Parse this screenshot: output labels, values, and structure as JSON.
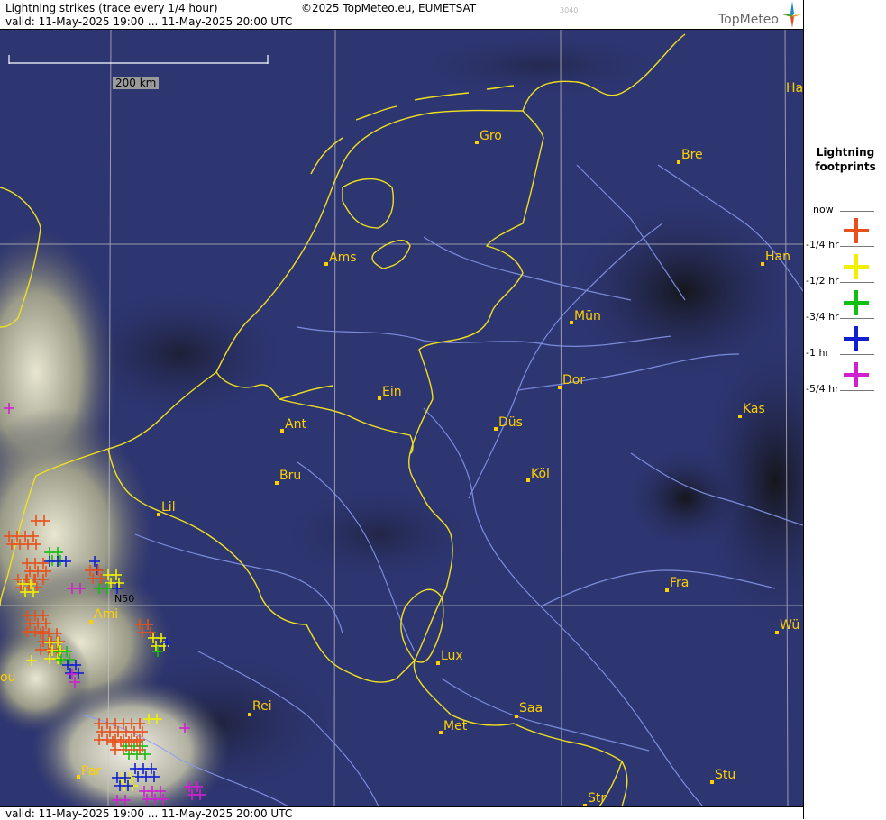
{
  "header": {
    "title": "Lightning strikes (trace every 1/4 hour)",
    "copyright": "©2025 TopMeteo.eu, EUMETSAT",
    "code": "3040",
    "valid": "valid:  11-May-2025 19:00 ... 11-May-2025 20:00 UTC",
    "logo": "TopMeteo"
  },
  "footer": {
    "valid": "valid:  11-May-2025 19:00 ... 11-May-2025 20:00 UTC"
  },
  "map": {
    "scale_label": "200 km",
    "lat_label": "N50",
    "cities": [
      "Gro",
      "Bre",
      "Ha",
      "Ams",
      "Han",
      "Mün",
      "Ein",
      "Ant",
      "Dor",
      "Düs",
      "Kas",
      "Bru",
      "Köl",
      "Lil",
      "Fra",
      "Ami",
      "Wü",
      "Lux",
      "ou",
      "Rei",
      "Saa",
      "Met",
      "Par",
      "Stu",
      "Str"
    ]
  },
  "legend": {
    "title_line1": "Lightning",
    "title_line2": "footprints",
    "entries": [
      {
        "label": "now",
        "color": "#e8501a"
      },
      {
        "label": "-1/4 hr",
        "color": "#f0f000"
      },
      {
        "label": "-1/2 hr",
        "color": "#10c010"
      },
      {
        "label": "-3/4 hr",
        "color": "#1020d0"
      },
      {
        "label": "-1 hr",
        "color": "#d020d0"
      },
      {
        "label": "-5/4 hr",
        "color": ""
      }
    ]
  },
  "colors": {
    "borders": "#f0e020",
    "rivers": "#8a9cf0",
    "land": "#2d3570",
    "city": "#ffd000"
  }
}
